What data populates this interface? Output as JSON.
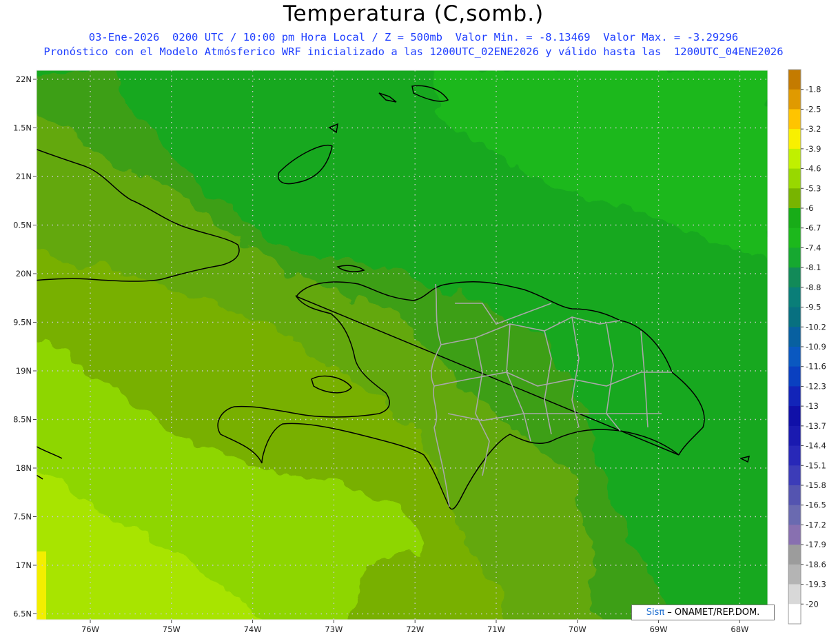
{
  "title": "Temperatura (C,somb.)",
  "subtitle_1": "03-Ene-2026  0200 UTC / 10:00 pm Hora Local / Z = 500mb  Valor Min. = -8.13469  Valor Max. = -3.29296",
  "subtitle_2": "Pronóstico con el Modelo Atmósferico WRF inicializado a las 1200UTC_02ENE2026 y válido hasta las  1200UTC_04ENE2026",
  "credit": {
    "brand": "Sisπ",
    "text": " – ONAMET/REP.DOM."
  },
  "lat_labels": [
    "22N",
    "1.5N",
    "21N",
    "0.5N",
    "20N",
    "9.5N",
    "19N",
    "8.5N",
    "18N",
    "7.5N",
    "17N",
    "6.5N"
  ],
  "lon_labels": [
    "76W",
    "75W",
    "74W",
    "73W",
    "72W",
    "71W",
    "70W",
    "69W",
    "68W"
  ],
  "colorbar": {
    "labels": [
      "-1.8",
      "-2.5",
      "-3.2",
      "-3.9",
      "-4.6",
      "-5.3",
      "-6",
      "-6.7",
      "-7.4",
      "-8.1",
      "-8.8",
      "-9.5",
      "-10.2",
      "-10.9",
      "-11.6",
      "-12.3",
      "-13",
      "-13.7",
      "-14.4",
      "-15.1",
      "-15.8",
      "-16.5",
      "-17.2",
      "-17.9",
      "-18.6",
      "-19.3",
      "-20"
    ],
    "colors": [
      "#c47b00",
      "#e09a00",
      "#ffc400",
      "#f8f000",
      "#c0f000",
      "#98d800",
      "#78b400",
      "#18ac18",
      "#1cb81c",
      "#16a830",
      "#128a58",
      "#0a7e78",
      "#087080",
      "#0860a0",
      "#0a58c0",
      "#0a40c0",
      "#1224b8",
      "#1010a8",
      "#1a1ab0",
      "#2828b8",
      "#3c3cb8",
      "#5454b0",
      "#6a6ab0",
      "#8870b0",
      "#9c9c9c",
      "#b4b4b4",
      "#d8d8d8",
      "#ffffff"
    ]
  },
  "field_colors": {
    "vivid_green": "#17a81f",
    "mid_green": "#5aa617",
    "olive": "#78b000",
    "light_green": "#8ed600",
    "lime": "#a8e400",
    "yellow": "#f2ee00"
  }
}
